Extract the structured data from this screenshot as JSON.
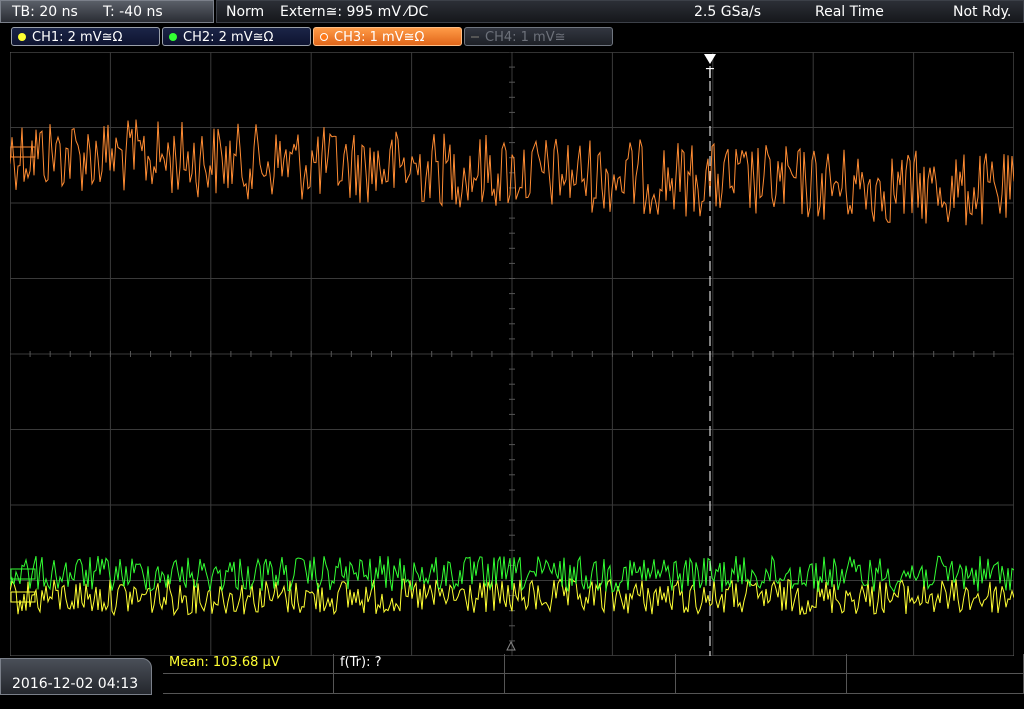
{
  "status": {
    "tb": "TB: 20 ns",
    "t": "T: -40 ns",
    "mode": "Norm",
    "trigger": "Extern≅: 995 mV ⁄DC",
    "sample_rate": "2.5 GSa/s",
    "acq": "Real Time",
    "ready": "Not Rdy."
  },
  "channels": [
    {
      "label": "CH1: 2 mV≅Ω",
      "color": "#ffff33"
    },
    {
      "label": "CH2: 2 mV≅Ω",
      "color": "#33ff33"
    },
    {
      "label": "CH3: 1 mV≅Ω",
      "color": "#ff8c33"
    },
    {
      "label": "CH4: 1 mV≅",
      "color": "#6d717a"
    }
  ],
  "trigger_marker": "T",
  "date": "2016-12-02 04:13",
  "measurements": {
    "mean_label": "Mean: 103.68 µV",
    "ftr_label": "f(Tr): ?"
  },
  "colors": {
    "grid": "#3a3a3a",
    "ch1": "#ffff33",
    "ch2": "#33ff33",
    "ch3": "#ff8c33"
  }
}
